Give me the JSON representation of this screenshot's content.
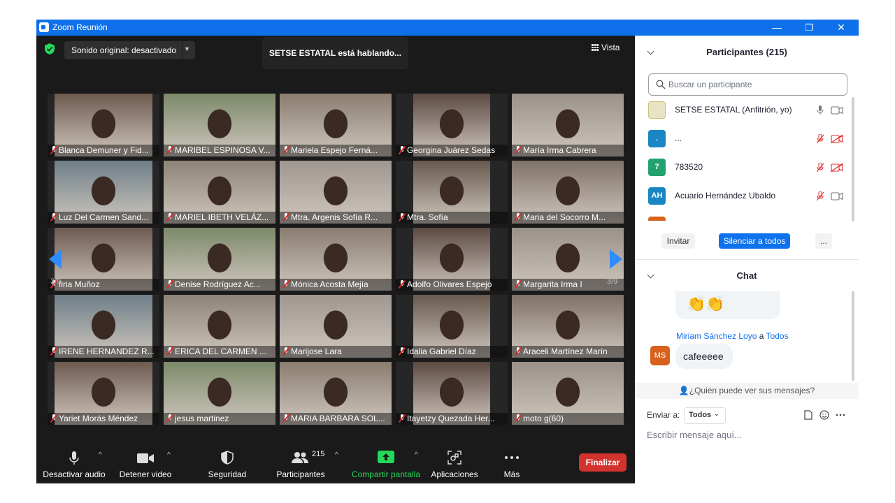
{
  "window": {
    "title": "Zoom Reunión",
    "controls": [
      "—",
      "❐",
      "✕"
    ]
  },
  "meeting": {
    "audio_dropdown": "Sonido original: desactivado",
    "speaking_banner": "SETSE ESTATAL está hablando...",
    "view_button": "Vista",
    "page_left": "3/9",
    "page_right": "3/9",
    "tiles": [
      {
        "name": "Blanca Demuner y Fid..."
      },
      {
        "name": "MARIBEL ESPINOSA V..."
      },
      {
        "name": "Mariela Espejo Ferná..."
      },
      {
        "name": "Georgina Juárez Sedas"
      },
      {
        "name": "María Irma Cabrera"
      },
      {
        "name": "Luz Del Carmen Sand..."
      },
      {
        "name": "MARIEL IBETH VELÁZ..."
      },
      {
        "name": "Mtra. Argenis Sofía R..."
      },
      {
        "name": "Mtra.  Sofía"
      },
      {
        "name": "Maria del Socorro M..."
      },
      {
        "name": "firia Muñoz"
      },
      {
        "name": "Denise Rodríguez Ac..."
      },
      {
        "name": "Mónica Acosta Mejía"
      },
      {
        "name": "Adolfo Olivares Espejo"
      },
      {
        "name": "Margarita Irma I"
      },
      {
        "name": "IRENE HERNANDEZ R..."
      },
      {
        "name": "ERICA DEL CARMEN ..."
      },
      {
        "name": "Marijose Lara"
      },
      {
        "name": "Idalia Gabriel Díaz"
      },
      {
        "name": "Araceli Martínez Marín"
      },
      {
        "name": "Yariet Morás Méndez"
      },
      {
        "name": "jesus martinez"
      },
      {
        "name": "MARIA BARBARA SOL..."
      },
      {
        "name": "Itayetzy Quezada Her..."
      },
      {
        "name": "moto g(60)"
      }
    ]
  },
  "toolbar": {
    "mute": "Desactivar audio",
    "video": "Detener video",
    "security": "Seguridad",
    "participants": "Participantes",
    "participants_count": "215",
    "share": "Compartir pantalla",
    "apps": "Aplicaciones",
    "more": "Más",
    "end": "Finalizar"
  },
  "participants_panel": {
    "title": "Participantes (215)",
    "search_placeholder": "Buscar un participante",
    "rows": [
      {
        "initials": "",
        "name": "SETSE ESTATAL (Anfitrión, yo)",
        "color": "#e8e3c4"
      },
      {
        "initials": ".",
        "name": "...",
        "color": "#1a86c4"
      },
      {
        "initials": "7",
        "name": "783520",
        "color": "#23a26e"
      },
      {
        "initials": "AH",
        "name": "Acuario Hernández Ubaldo",
        "color": "#1a86c4"
      }
    ],
    "invite": "Invitar",
    "mute_all": "Silenciar a todos",
    "more": "..."
  },
  "chat_panel": {
    "title": "Chat",
    "reaction": "👏👏",
    "sender": "Miriam Sánchez Loyo",
    "connector": "a",
    "recipient": "Todos",
    "sender_initials": "MS",
    "message": "cafeeeee",
    "who_can_see": "¿Quién puede ver sus mensajes?",
    "send_to_label": "Enviar a:",
    "send_to_value": "Todos",
    "composer_placeholder": "Escribir mensaje aquí..."
  }
}
